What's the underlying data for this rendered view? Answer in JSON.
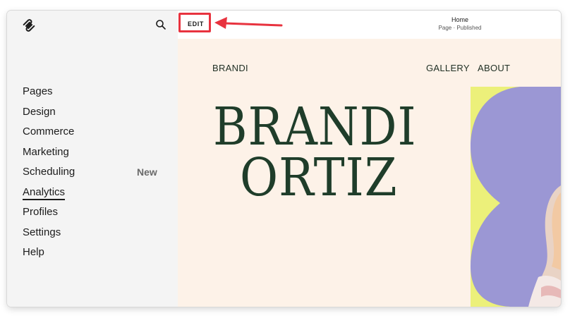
{
  "sidebar": {
    "logo_icon": "squarespace-logo-icon",
    "search_icon": "search-icon",
    "items": [
      {
        "label": "Pages",
        "badge": ""
      },
      {
        "label": "Design",
        "badge": ""
      },
      {
        "label": "Commerce",
        "badge": ""
      },
      {
        "label": "Marketing",
        "badge": ""
      },
      {
        "label": "Scheduling",
        "badge": "New"
      },
      {
        "label": "Analytics",
        "badge": ""
      },
      {
        "label": "Profiles",
        "badge": ""
      },
      {
        "label": "Settings",
        "badge": ""
      },
      {
        "label": "Help",
        "badge": ""
      }
    ],
    "active_item": "Analytics"
  },
  "topbar": {
    "edit_label": "EDIT",
    "page_title": "Home",
    "page_status": "Page · Published",
    "highlight_color": "#e8333f"
  },
  "site": {
    "brand": "BRANDI",
    "nav": [
      "GALLERY",
      "ABOUT"
    ],
    "hero_line1": "BRANDI",
    "hero_line2": "ORTIZ",
    "background": "#fdf2e8",
    "text_color": "#1f3d2a",
    "accent_yellow": "#ecf07a",
    "accent_purple": "#9b97d4"
  }
}
